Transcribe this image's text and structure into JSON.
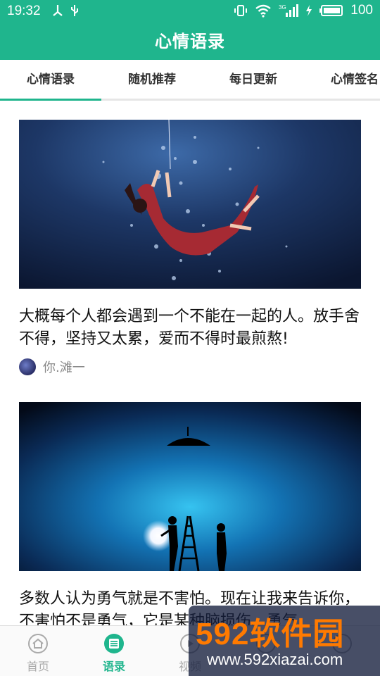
{
  "status_bar": {
    "time": "19:32",
    "battery": "100",
    "network": "3G"
  },
  "header": {
    "title": "心情语录"
  },
  "tabs": [
    {
      "label": "心情语录",
      "active": true
    },
    {
      "label": "随机推荐"
    },
    {
      "label": "每日更新"
    },
    {
      "label": "心情签名"
    }
  ],
  "cards": [
    {
      "quote": "大概每个人都会遇到一个不能在一起的人。放手舍不得，坚持又太累，爱而不得时最煎熬!",
      "author": "你.滩一",
      "image": "girl-falling-underwater"
    },
    {
      "quote": "多数人认为勇气就是不害怕。现在让我来告诉你，不害怕不是勇气，它是某种脑损伤。勇气",
      "image": "silhouettes-with-lamp"
    }
  ],
  "bottom_nav": [
    {
      "label": "首页",
      "icon": "home-icon"
    },
    {
      "label": "语录",
      "icon": "quote-icon",
      "active": true
    },
    {
      "label": "视频",
      "icon": "video-icon"
    },
    {
      "label": "",
      "icon": "profile-icon"
    },
    {
      "label": "",
      "icon": "more-icon"
    }
  ],
  "watermark": {
    "brand": "592软件园",
    "url": "www.592xiazai.com"
  },
  "colors": {
    "accent": "#1fb58d"
  }
}
